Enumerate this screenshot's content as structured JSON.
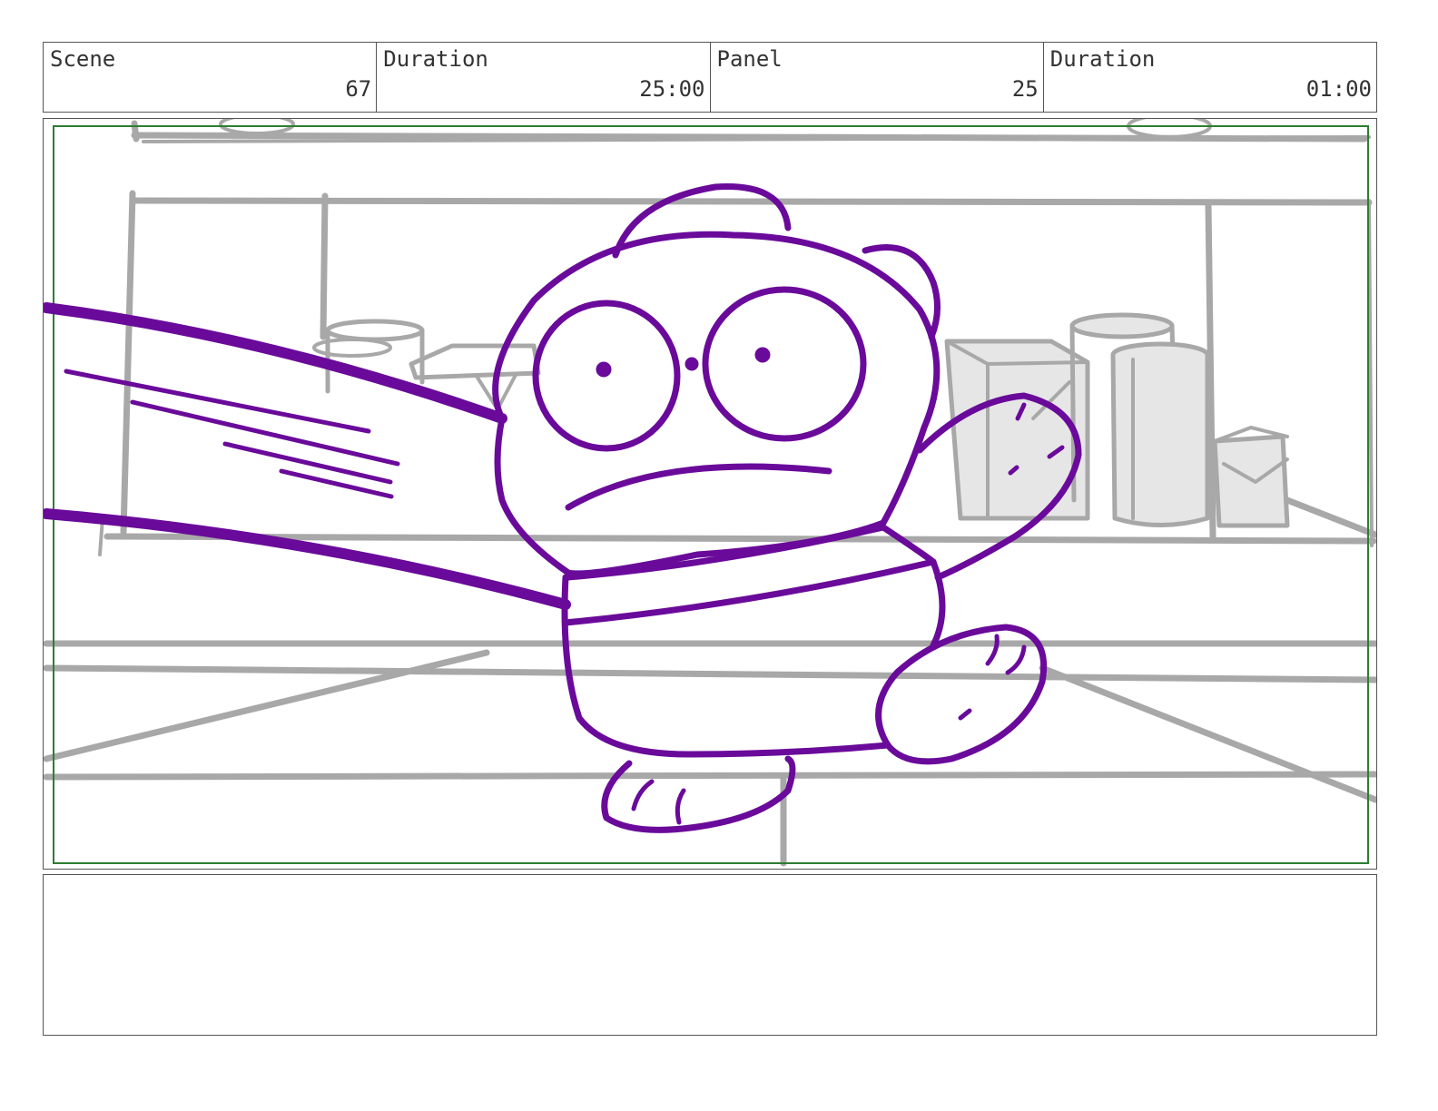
{
  "header": {
    "scene": {
      "label": "Scene",
      "value": "67"
    },
    "scene_duration": {
      "label": "Duration",
      "value": "25:00"
    },
    "panel": {
      "label": "Panel",
      "value": "25"
    },
    "panel_duration": {
      "label": "Duration",
      "value": "01:00"
    }
  },
  "panel_art": {
    "character_color": "#6a0a9a",
    "background_color": "#a8a8a8",
    "safe_frame_color": "#2e7d32"
  },
  "notes": {
    "text": ""
  }
}
